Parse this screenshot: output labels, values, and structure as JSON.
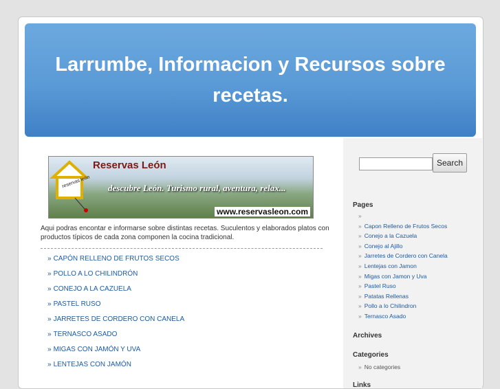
{
  "header": {
    "title": "Larrumbe, Informacion y Recursos sobre recetas."
  },
  "banner": {
    "logo_text": "Reservas León",
    "tagline": "descubre León. Turismo rural, aventura, relax...",
    "url": "www.reservasleon.com",
    "sign_text": "reservas león"
  },
  "intro": "Aqui podras encontar e informarse sobre distintas recetas. Suculentos y elaborados platos con productos típicos de cada zona componen la cocina tradicional.",
  "recipes": [
    "CAPÓN RELLENO DE FRUTOS SECOS",
    "POLLO A LO CHILINDRÓN",
    "CONEJO A LA CAZUELA",
    "PASTEL RUSO",
    "JARRETES DE CORDERO CON CANELA",
    "TERNASCO ASADO",
    "MIGAS CON JAMÓN Y UVA",
    "LENTEJAS CON JAMÓN"
  ],
  "bullet": "»",
  "sidebar": {
    "search_button": "Search",
    "search_value": "",
    "pages_heading": "Pages",
    "pages": [
      "",
      "Capon Relleno de Frutos Secos",
      "Conejo a la Cazuela",
      "Conejo al Ajillo",
      "Jarretes de Cordero con Canela",
      "Lentejas con Jamon",
      "Migas con Jamon y Uva",
      "Pastel Ruso",
      "Patatas Rellenas",
      "Pollo a lo Chilindron",
      "Ternasco Asado"
    ],
    "archives_heading": "Archives",
    "categories_heading": "Categories",
    "categories_empty": "No categories",
    "links_heading": "Links"
  },
  "colors": {
    "header": "#5a9ad6",
    "link": "#1e5aa0",
    "sidebar_bg": "#f2f2f2"
  }
}
